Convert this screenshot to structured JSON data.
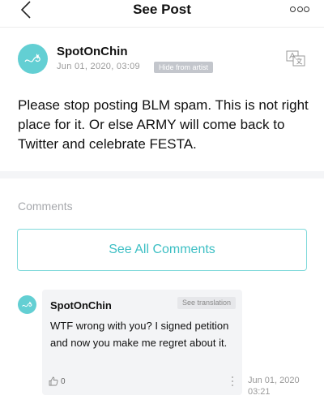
{
  "header": {
    "title": "See Post",
    "back_icon": "chevron-left-icon",
    "more_icon": "more-options-icon"
  },
  "post": {
    "author": "SpotOnChin",
    "date": "Jun 01, 2020, 03:09",
    "hide_badge": "Hide from artist",
    "translate_icon": "translate-icon",
    "body": "Please stop posting BLM spam. This is not right place for it. Or else ARMY  will come back to Twitter and celebrate FESTA."
  },
  "comments": {
    "section_label": "Comments",
    "see_all_label": "See All Comments",
    "items": [
      {
        "author": "SpotOnChin",
        "see_translation": "See translation",
        "text": "WTF wrong with you? I signed petition and now you make me regret about it.",
        "likes": "0",
        "date_line1": "Jun 01, 2020",
        "date_line2": "03:21"
      }
    ]
  },
  "colors": {
    "accent": "#3dbfc4",
    "avatar": "#63cfd3",
    "badge": "#c3c6cc"
  }
}
